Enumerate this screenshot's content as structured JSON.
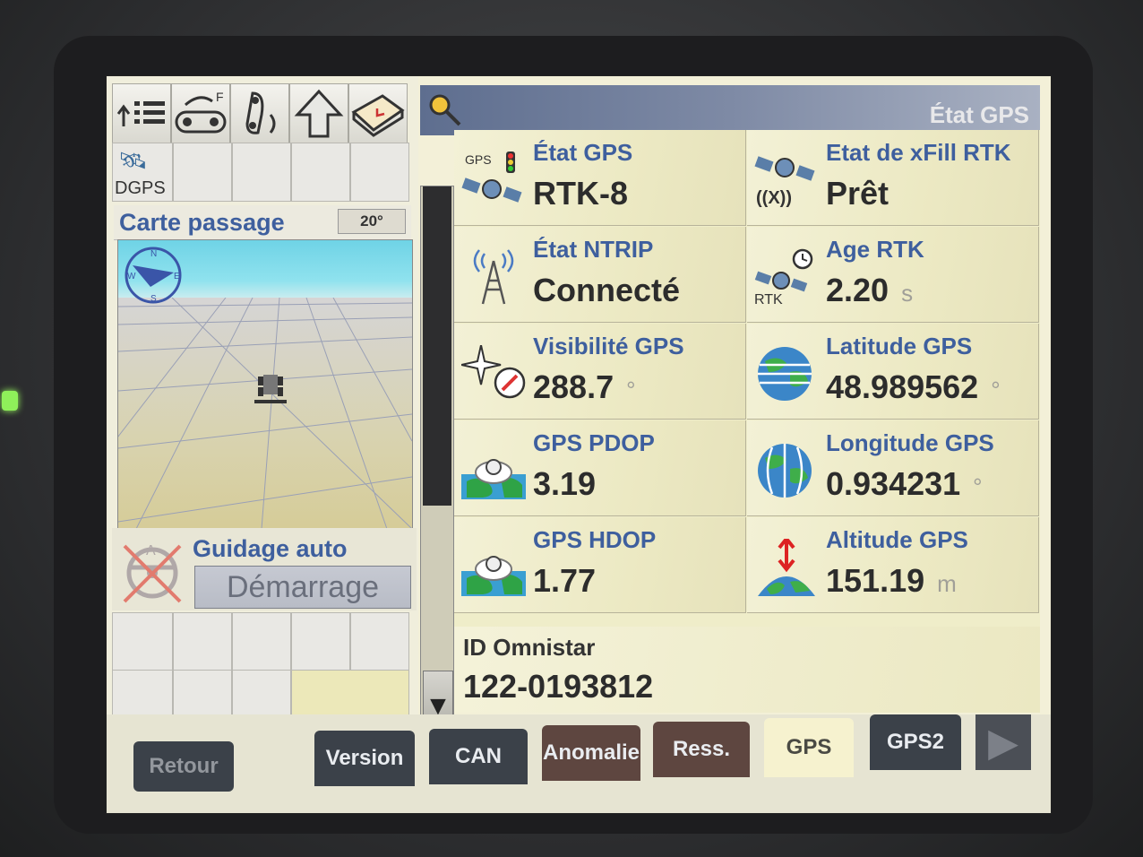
{
  "header": {
    "title": "État GPS"
  },
  "map": {
    "title": "Carte passage",
    "angle": "20°"
  },
  "guidage": {
    "title": "Guidage auto",
    "button_label": "Démarrage"
  },
  "dgps": {
    "label": "DGPS"
  },
  "cells": {
    "gps_state": {
      "label": "État GPS",
      "value": "RTK-8",
      "icon_text": "GPS"
    },
    "xfill_state": {
      "label": "Etat de xFill RTK",
      "value": "Prêt",
      "icon_text": "((X))"
    },
    "ntrip_state": {
      "label": "État NTRIP",
      "value": "Connecté"
    },
    "rtk_age": {
      "label": "Age RTK",
      "value": "2.20",
      "unit": "s",
      "icon_text": "RTK"
    },
    "gps_visibility": {
      "label": "Visibilité GPS",
      "value": "288.7",
      "unit": "°"
    },
    "gps_latitude": {
      "label": "Latitude GPS",
      "value": "48.989562",
      "unit": "°"
    },
    "gps_pdop": {
      "label": "GPS PDOP",
      "value": "3.19"
    },
    "gps_longitude": {
      "label": "Longitude GPS",
      "value": "0.934231",
      "unit": "°"
    },
    "gps_hdop": {
      "label": "GPS HDOP",
      "value": "1.77"
    },
    "gps_altitude": {
      "label": "Altitude GPS",
      "value": "151.19",
      "unit": "m"
    }
  },
  "omnistar": {
    "label": "ID Omnistar",
    "value": "122-0193812"
  },
  "tabs": {
    "retour": "Retour",
    "version": "Version",
    "can": "CAN",
    "anomalie": "Anomalie",
    "ress": "Ress.",
    "gps": "GPS",
    "gps2": "GPS2"
  },
  "icons": {
    "toolbar": [
      "menu-list-icon",
      "implement-icon",
      "hitch-icon",
      "up-arrow-icon",
      "book-icon"
    ],
    "search": "magnifier-icon",
    "next": "next-arrow-icon"
  },
  "colors": {
    "label_blue": "#3e5f9e",
    "sky": "#6fd3e6",
    "panel": "#efedc9",
    "tab_dark": "#3b4149",
    "tab_brown": "#5e4640",
    "tab_active": "#f6f2cf"
  }
}
